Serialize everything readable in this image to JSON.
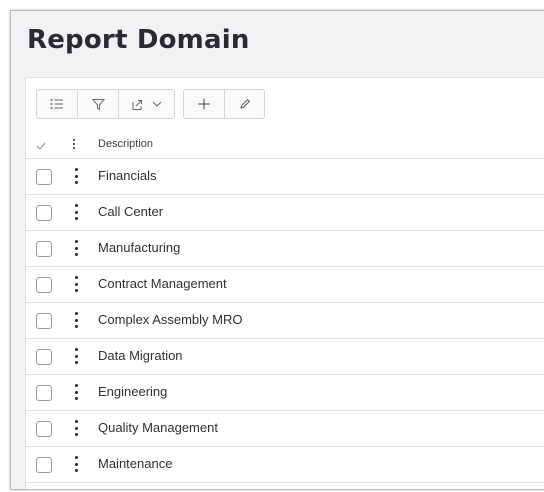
{
  "page": {
    "title": "Report Domain"
  },
  "toolbar": {
    "icons": [
      "list-icon",
      "filter-icon",
      "export-icon",
      "chevron-down-icon",
      "plus-icon",
      "edit-icon"
    ]
  },
  "table": {
    "columns": {
      "description": "Description"
    },
    "rows": [
      {
        "description": "Financials"
      },
      {
        "description": "Call Center"
      },
      {
        "description": "Manufacturing"
      },
      {
        "description": "Contract Management"
      },
      {
        "description": "Complex Assembly MRO"
      },
      {
        "description": "Data Migration"
      },
      {
        "description": "Engineering"
      },
      {
        "description": "Quality Management"
      },
      {
        "description": "Maintenance"
      }
    ]
  }
}
